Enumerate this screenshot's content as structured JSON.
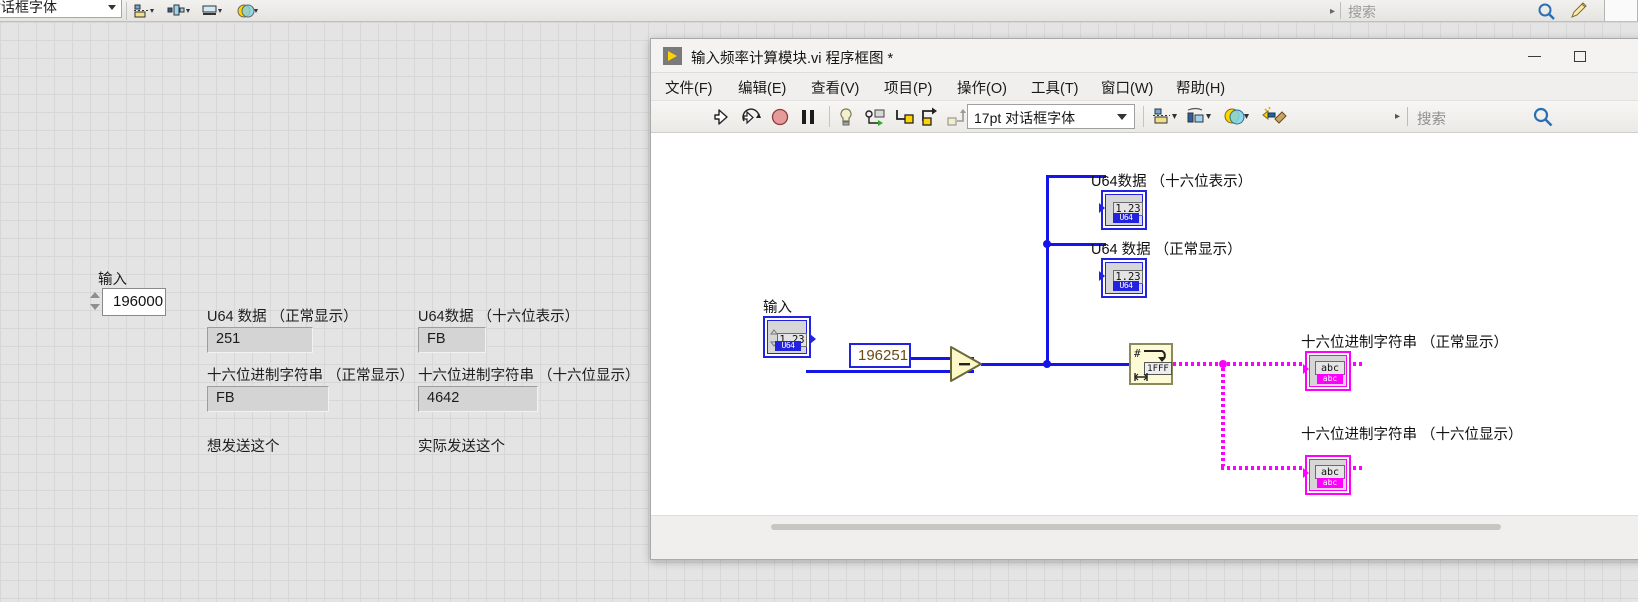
{
  "front_panel": {
    "font_selector": "对话框字体",
    "search_placeholder": "搜索",
    "controls": {
      "input_label": "输入",
      "input_value": "196000",
      "fields": [
        {
          "label": "U64 数据 （正常显示）",
          "value": "251"
        },
        {
          "label": "U64数据 （十六位表示）",
          "value": "FB"
        },
        {
          "label": "十六位进制字符串 （正常显示）",
          "value": "FB"
        },
        {
          "label": "十六位进制字符串 （十六位显示）",
          "value": "4642"
        }
      ],
      "note_left": "想发送这个",
      "note_right": "实际发送这个"
    },
    "toolbar_icons": [
      "align-objects-icon",
      "distribute-objects-icon",
      "resize-objects-icon",
      "reorder-icon"
    ]
  },
  "block_diagram": {
    "title": "输入频率计算模块.vi 程序框图 *",
    "app_icon": "labview-vi-icon",
    "window_buttons": {
      "minimize": "–",
      "maximize": "□",
      "close": "✕"
    },
    "menu": [
      "文件(F)",
      "编辑(E)",
      "查看(V)",
      "项目(P)",
      "操作(O)",
      "工具(T)",
      "窗口(W)",
      "帮助(H)"
    ],
    "toolbar": {
      "font_selector": "17pt 对话框字体",
      "search_placeholder": "搜索",
      "icons": [
        "run-icon",
        "run-continuously-icon",
        "abort-execution-icon",
        "pause-icon",
        "highlight-execution-icon",
        "retain-wire-values-icon",
        "step-into-icon",
        "step-over-icon",
        "step-out-icon",
        "align-objects-icon",
        "distribute-objects-icon",
        "resize-objects-icon",
        "reorder-icon",
        "clean-up-diagram-icon",
        "search-icon"
      ]
    },
    "diagram": {
      "input_terminal": {
        "label": "输入",
        "glyph": "1.23",
        "type_tag": "U64"
      },
      "constant": {
        "value": "196251"
      },
      "operator": {
        "name": "subtract-function",
        "symbol": "–"
      },
      "indicators": [
        {
          "label": "U64数据 （十六位表示）",
          "glyph": "1.23",
          "type_tag": "U64"
        },
        {
          "label": "U64 数据 （正常显示）",
          "glyph": "1.23",
          "type_tag": "U64"
        }
      ],
      "hex_node": {
        "name": "number-to-hexadecimal-string-function",
        "glyph_hash": "#",
        "glyph_value": "1FFF"
      },
      "string_indicators": [
        {
          "label": "十六位进制字符串 （正常显示）",
          "glyph": "abc"
        },
        {
          "label": "十六位进制字符串 （十六位显示）",
          "glyph": "abc"
        }
      ]
    }
  },
  "colors": {
    "wire_numeric": "#1515e8",
    "wire_string": "#ff00ff",
    "function_node": "#fcfbd6",
    "terminal_border": "#2222e0",
    "string_border": "#ff00ff"
  }
}
